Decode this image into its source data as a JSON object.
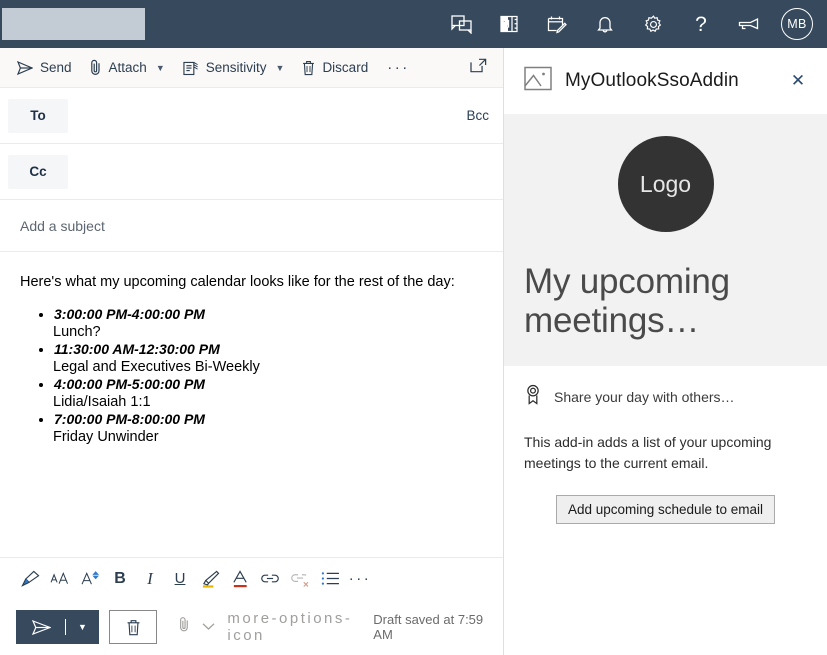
{
  "header": {
    "search_placeholder": "",
    "icons": [
      {
        "name": "teams-chat-icon",
        "label": "Teams chat"
      },
      {
        "name": "onenote-icon",
        "label": "OneNote"
      },
      {
        "name": "tasks-icon",
        "label": "My Day"
      },
      {
        "name": "notifications-bell-icon",
        "label": "Notifications"
      },
      {
        "name": "settings-gear-icon",
        "label": "Settings"
      },
      {
        "name": "help-icon",
        "label": "?"
      },
      {
        "name": "feedback-megaphone-icon",
        "label": "Feedback"
      }
    ],
    "avatar_initials": "MB",
    "background_color": "#37495c"
  },
  "compose": {
    "toolbar": {
      "send_label": "Send",
      "attach_label": "Attach",
      "sensitivity_label": "Sensitivity",
      "discard_label": "Discard",
      "more_label": "···",
      "popout_name": "pop-out-icon"
    },
    "fields": {
      "to_label": "To",
      "bcc_label": "Bcc",
      "cc_label": "Cc",
      "subject_placeholder": "Add a subject"
    },
    "body": {
      "intro": "Here's what my upcoming calendar looks like for the rest of the day:",
      "meetings": [
        {
          "time": "3:00:00 PM-4:00:00 PM",
          "name": "Lunch?"
        },
        {
          "time": "11:30:00 AM-12:30:00 PM",
          "name": "Legal and Executives Bi-Weekly"
        },
        {
          "time": "4:00:00 PM-5:00:00 PM",
          "name": "Lidia/Isaiah 1:1"
        },
        {
          "time": "7:00:00 PM-8:00:00 PM",
          "name": "Friday Unwinder"
        }
      ]
    },
    "format_toolbar": [
      {
        "name": "format-painter-icon",
        "glyph": ""
      },
      {
        "name": "font-size-icon",
        "glyph": ""
      },
      {
        "name": "font-grow-icon",
        "glyph": ""
      },
      {
        "name": "bold-icon",
        "glyph": "B"
      },
      {
        "name": "italic-icon",
        "glyph": "I"
      },
      {
        "name": "underline-icon",
        "glyph": "U"
      },
      {
        "name": "highlight-icon",
        "glyph": ""
      },
      {
        "name": "font-color-icon",
        "glyph": "A"
      },
      {
        "name": "insert-link-icon",
        "glyph": ""
      },
      {
        "name": "remove-link-icon",
        "glyph": ""
      },
      {
        "name": "bulleted-list-icon",
        "glyph": ""
      },
      {
        "name": "more-formatting-icon",
        "glyph": "···"
      }
    ],
    "send_bar": {
      "send_name": "send-button",
      "discard_name": "discard-button",
      "attach_name": "attach-icon",
      "more_name": "more-options-icon",
      "draft_status": "Draft saved at 7:59 AM"
    }
  },
  "addin": {
    "title": "MyOutlookSsoAddin",
    "app_icon_name": "image-placeholder-icon",
    "close_label": "✕",
    "logo_text": "Logo",
    "hero_title": "My upcoming meetings…",
    "feature_icon_name": "ribbon-badge-icon",
    "feature_label": "Share your day with others…",
    "description": "This add-in adds a list of your upcoming meetings to the current email.",
    "button_label": "Add upcoming schedule to email"
  }
}
